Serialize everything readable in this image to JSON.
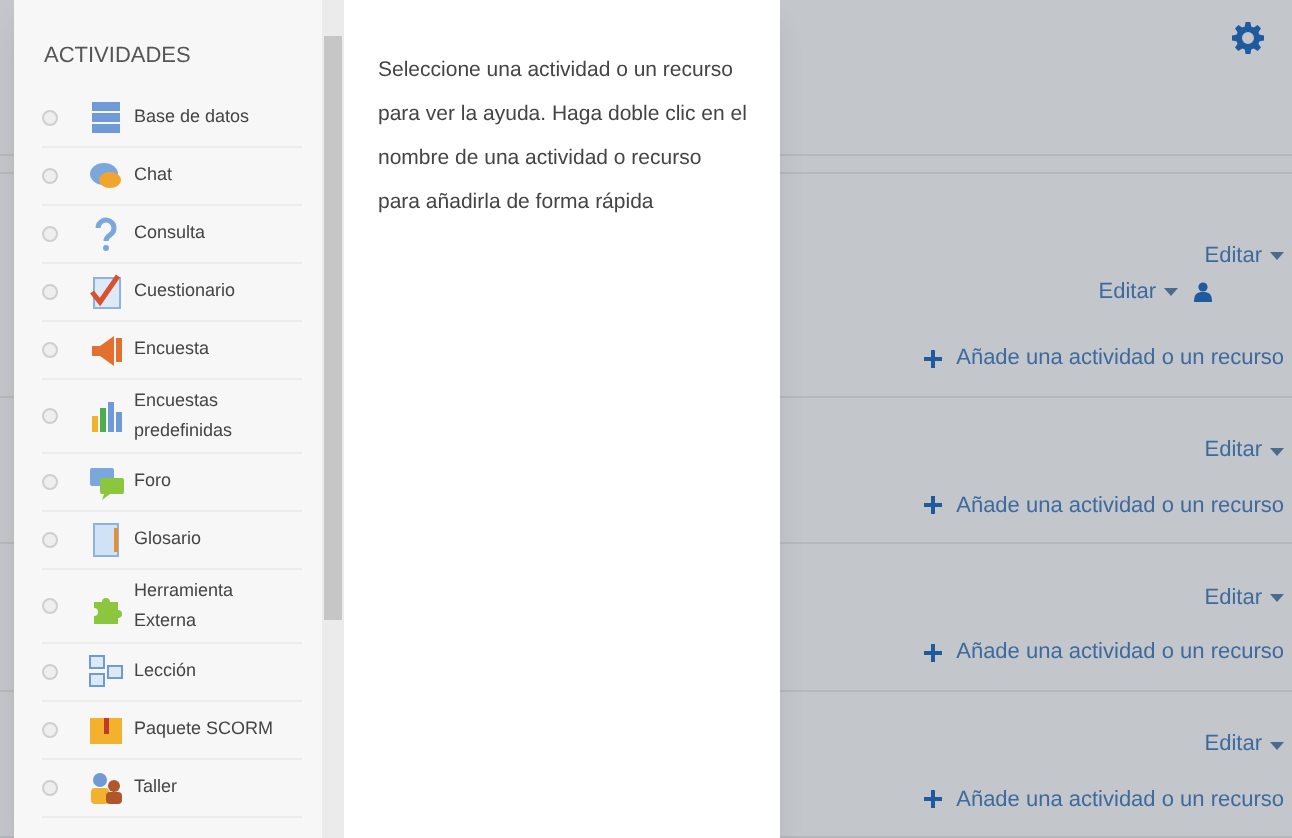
{
  "dialog": {
    "title": "ACTIVIDADES",
    "options": [
      {
        "label": "Base de datos",
        "selected": false
      },
      {
        "label": "Chat",
        "selected": false
      },
      {
        "label": "Consulta",
        "selected": false
      },
      {
        "label": "Cuestionario",
        "selected": false
      },
      {
        "label": "Encuesta",
        "selected": false
      },
      {
        "label": "Encuestas predefinidas",
        "selected": false
      },
      {
        "label": "Foro",
        "selected": false
      },
      {
        "label": "Glosario",
        "selected": false
      },
      {
        "label": "Herramienta Externa",
        "selected": false
      },
      {
        "label": "Lección",
        "selected": false
      },
      {
        "label": "Paquete SCORM",
        "selected": false
      },
      {
        "label": "Taller",
        "selected": false
      }
    ],
    "help_text": "Seleccione una actividad o un recurso para ver la ayuda. Haga doble clic en el nombre de una actividad o recurso para añadirla de forma rápida"
  },
  "page": {
    "sections": [
      {
        "edit_links": [
          "Editar",
          "Editar"
        ],
        "add_link": "Añade una actividad o un recurso"
      },
      {
        "edit_links": [
          "Editar"
        ],
        "add_link": "Añade una actividad o un recurso"
      },
      {
        "edit_links": [
          "Editar"
        ],
        "add_link": "Añade una actividad o un recurso"
      },
      {
        "edit_links": [
          "Editar"
        ],
        "add_link": "Añade una actividad o un recurso"
      }
    ]
  }
}
